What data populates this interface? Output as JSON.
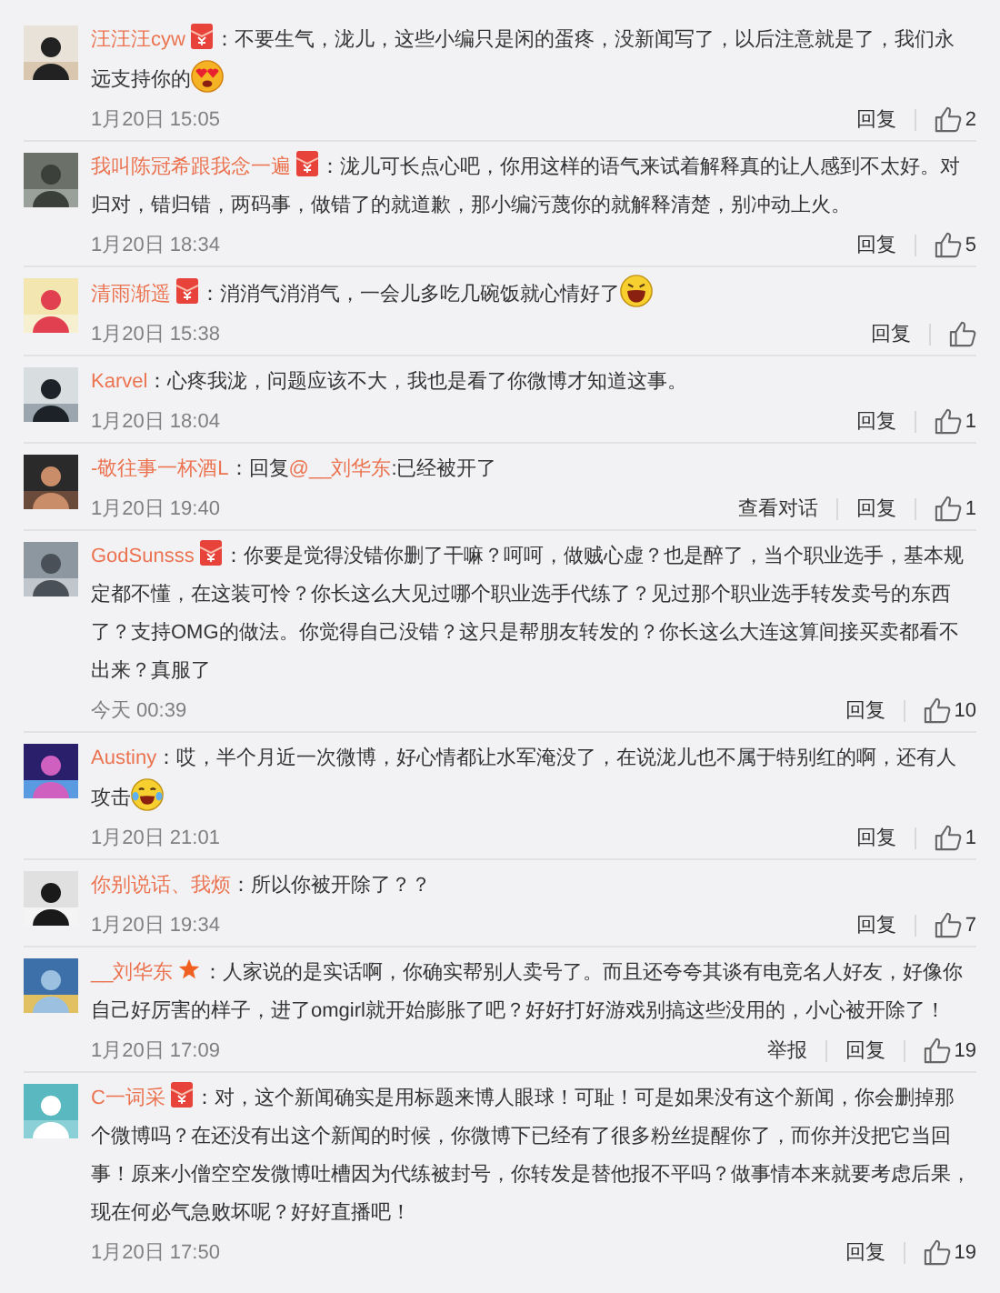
{
  "comments": [
    {
      "author": "汪汪汪cyw",
      "badge": {
        "kind": "envelope"
      },
      "segments": [
        {
          "kind": "text",
          "text": "：不要生气，泷儿，这些小编只是闲的蛋疼，没新闻写了，以后注意就是了，我们永远支持你的"
        },
        {
          "kind": "heart_eyes_emoji"
        }
      ],
      "time": "1月20日 15:05",
      "actions": [
        "回复"
      ],
      "likes": "2"
    },
    {
      "author": "我叫陈冠希跟我念一遍",
      "badge": {
        "kind": "envelope"
      },
      "segments": [
        {
          "kind": "text",
          "text": "：泷儿可长点心吧，你用这样的语气来试着解释真的让人感到不太好。对归对，错归错，两码事，做错了的就道歉，那小编污蔑你的就解释清楚，别冲动上火。"
        }
      ],
      "time": "1月20日 18:34",
      "actions": [
        "回复"
      ],
      "likes": "5"
    },
    {
      "author": "清雨渐遥",
      "badge": {
        "kind": "envelope"
      },
      "segments": [
        {
          "kind": "text",
          "text": "：消消气消消气，一会儿多吃几碗饭就心情好了"
        },
        {
          "kind": "laugh_emoji"
        }
      ],
      "time": "1月20日 15:38",
      "actions": [
        "回复"
      ]
    },
    {
      "author": "Karvel",
      "segments": [
        {
          "kind": "text",
          "text": "：心疼我泷，问题应该不大，我也是看了你微博才知道这事。"
        }
      ],
      "time": "1月20日 18:04",
      "actions": [
        "回复"
      ],
      "likes": "1"
    },
    {
      "author": "-敬往事一杯酒L",
      "segments": [
        {
          "kind": "text",
          "text": "：回复"
        },
        {
          "kind": "mention",
          "text": "@__刘华东"
        },
        {
          "kind": "text",
          "text": ":已经被开了"
        }
      ],
      "time": "1月20日 19:40",
      "actions": [
        "查看对话",
        "回复"
      ],
      "likes": "1"
    },
    {
      "author": "GodSunsss",
      "badge": {
        "kind": "envelope"
      },
      "segments": [
        {
          "kind": "text",
          "text": "：你要是觉得没错你删了干嘛？呵呵，做贼心虚？也是醉了，当个职业选手，基本规定都不懂，在这装可怜？你长这么大见过哪个职业选手代练了？见过那个职业选手转发卖号的东西了？支持OMG的做法。你觉得自己没错？这只是帮朋友转发的？你长这么大连这算间接买卖都看不出来？真服了"
        }
      ],
      "time": "今天 00:39",
      "actions": [
        "回复"
      ],
      "likes": "10"
    },
    {
      "author": "Austiny",
      "segments": [
        {
          "kind": "text",
          "text": "：哎，半个月近一次微博，好心情都让水军淹没了，在说泷儿也不属于特别红的啊，还有人攻击"
        },
        {
          "kind": "tears_emoji"
        }
      ],
      "time": "1月20日 21:01",
      "actions": [
        "回复"
      ],
      "likes": "1"
    },
    {
      "author": "你别说话、我烦",
      "segments": [
        {
          "kind": "text",
          "text": "：所以你被开除了？？"
        }
      ],
      "time": "1月20日 19:34",
      "actions": [
        "回复"
      ],
      "likes": "7"
    },
    {
      "author": "__刘华东",
      "badge": {
        "kind": "star"
      },
      "segments": [
        {
          "kind": "text",
          "text": "：人家说的是实话啊，你确实帮别人卖号了。而且还夸夸其谈有电竞名人好友，好像你自己好厉害的样子，进了omgirl就开始膨胀了吧？好好打好游戏别搞这些没用的，小心被开除了！"
        }
      ],
      "time": "1月20日 17:09",
      "actions": [
        "举报",
        "回复"
      ],
      "likes": "19"
    },
    {
      "author": "C一词采",
      "badge": {
        "kind": "envelope"
      },
      "segments": [
        {
          "kind": "text",
          "text": "：对，这个新闻确实是用标题来博人眼球！可耻！可是如果没有这个新闻，你会删掉那个微博吗？在还没有出这个新闻的时候，你微博下已经有了很多粉丝提醒你了，而你并没把它当回事！原来小僧空空发微博吐槽因为代练被封号，你转发是替他报不平吗？做事情本来就要考虑后果，现在何必气急败坏呢？好好直播吧！"
        }
      ],
      "time": "1月20日 17:50",
      "actions": [
        "回复"
      ],
      "likes": "19"
    }
  ]
}
